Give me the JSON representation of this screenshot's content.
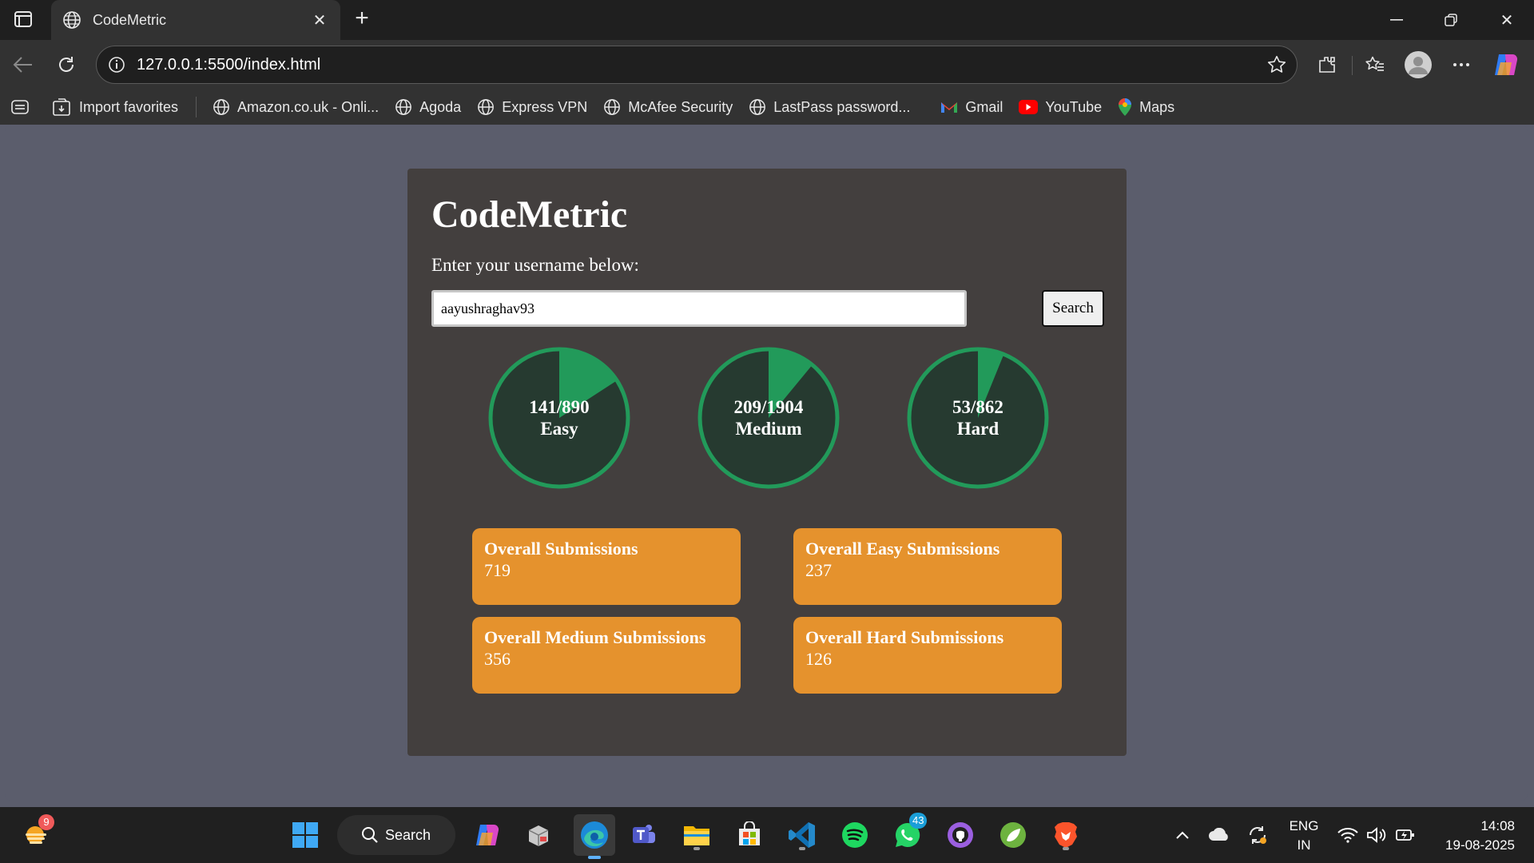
{
  "browser": {
    "tab_title": "CodeMetric",
    "url": "127.0.0.1:5500/index.html",
    "bookmarks": [
      {
        "label": "Import favorites",
        "icon": "import-icon"
      },
      {
        "label": "Amazon.co.uk - Onli...",
        "icon": "globe-icon"
      },
      {
        "label": "Agoda",
        "icon": "globe-icon"
      },
      {
        "label": "Express VPN",
        "icon": "globe-icon"
      },
      {
        "label": "McAfee Security",
        "icon": "globe-icon"
      },
      {
        "label": "LastPass password...",
        "icon": "globe-icon"
      },
      {
        "label": "Gmail",
        "icon": "gmail-icon"
      },
      {
        "label": "YouTube",
        "icon": "youtube-icon"
      },
      {
        "label": "Maps",
        "icon": "maps-icon"
      }
    ]
  },
  "app": {
    "title": "CodeMetric",
    "prompt": "Enter your username below:",
    "username": "aayushraghav93",
    "search_label": "Search",
    "progress": [
      {
        "solved_text": "141/890",
        "label": "Easy",
        "solved": 141,
        "total": 890
      },
      {
        "solved_text": "209/1904",
        "label": "Medium",
        "solved": 209,
        "total": 1904
      },
      {
        "solved_text": "53/862",
        "label": "Hard",
        "solved": 53,
        "total": 862
      }
    ],
    "stats": [
      {
        "label": "Overall Submissions",
        "value": "719"
      },
      {
        "label": "Overall Easy Submissions",
        "value": "237"
      },
      {
        "label": "Overall Medium Submissions",
        "value": "356"
      },
      {
        "label": "Overall Hard Submissions",
        "value": "126"
      }
    ],
    "colors": {
      "ring_fill": "#229a5a",
      "ring_track": "#263a30",
      "stat_bg": "#e5922d",
      "card_bg": "#433f3e"
    }
  },
  "taskbar": {
    "search_label": "Search",
    "weather_badge": "9",
    "whatsapp_badge": "43",
    "lang_top": "ENG",
    "lang_bottom": "IN",
    "time": "14:08",
    "date": "19-08-2025"
  }
}
